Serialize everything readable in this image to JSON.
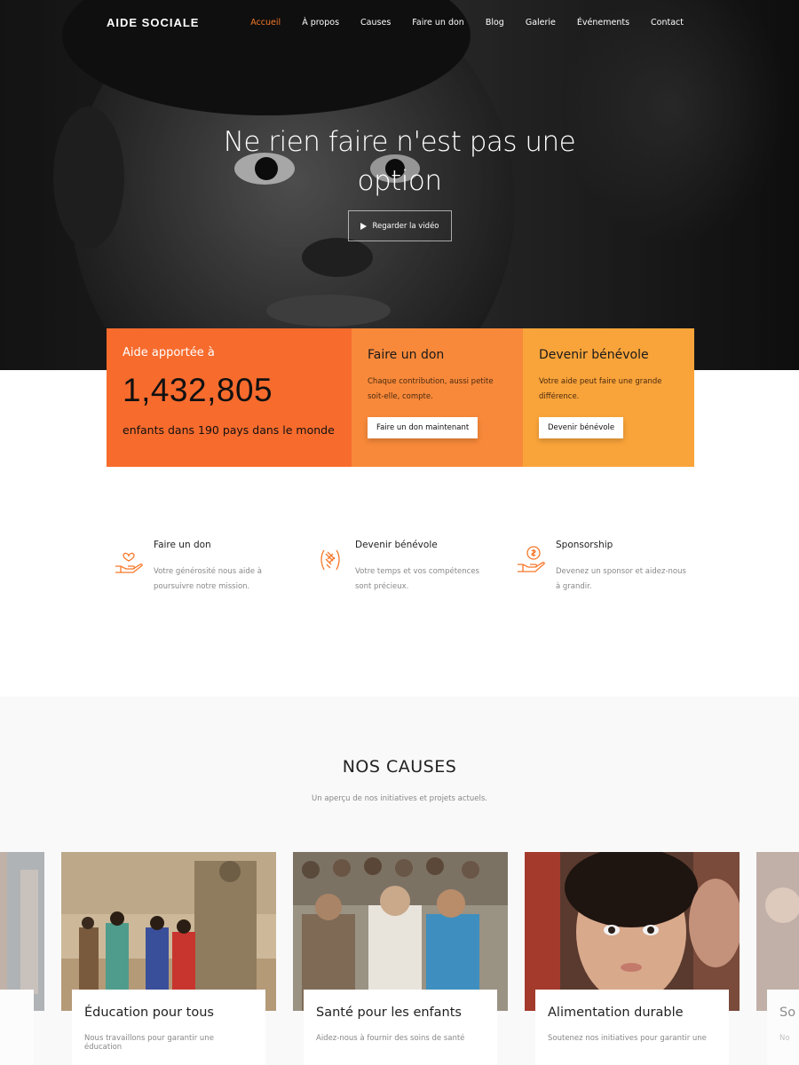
{
  "brand": "AIDE SOCIALE",
  "nav": {
    "items": [
      "Accueil",
      "À propos",
      "Causes",
      "Faire un don",
      "Blog",
      "Galerie",
      "Événements",
      "Contact"
    ],
    "active": "Accueil"
  },
  "hero": {
    "title_line1": "Ne rien faire n'est pas une",
    "title_line2": "option",
    "video_button": "Regarder la vidéo",
    "video_icon": "play-icon"
  },
  "stats": {
    "label": "Aide apportée à",
    "number": "1,432,805",
    "subtitle": "enfants dans 190 pays dans le monde"
  },
  "donate_box": {
    "title": "Faire un don",
    "text_line1": "Chaque contribution, aussi petite",
    "text_line2": "soit-elle, compte.",
    "button": "Faire un don maintenant"
  },
  "volunteer_box": {
    "title": "Devenir bénévole",
    "text_line1": "Votre aide peut faire une grande",
    "text_line2": "différence.",
    "button": "Devenir bénévole"
  },
  "features": [
    {
      "icon": "heart-hand-icon",
      "title": "Faire un don",
      "text_line1": "Votre générosité nous aide à",
      "text_line2": "poursuivre notre mission."
    },
    {
      "icon": "hands-icon",
      "title": "Devenir bénévole",
      "text_line1": "Votre temps et vos compétences",
      "text_line2": "sont précieux."
    },
    {
      "icon": "coin-hand-icon",
      "title": "Sponsorship",
      "text_line1": "Devenez un sponsor et aidez-nous",
      "text_line2": "à grandir."
    }
  ],
  "causes": {
    "title": "NOS CAUSES",
    "subtitle": "Un aperçu de nos initiatives et projets actuels.",
    "cards": [
      {
        "title": "Éducation pour tous",
        "text": "Nous travaillons pour garantir une éducation"
      },
      {
        "title": "Santé pour les enfants",
        "text": "Aidez-nous à fournir des soins de santé"
      },
      {
        "title": "Alimentation durable",
        "text": "Soutenez nos initiatives pour garantir une"
      }
    ],
    "partial_right": {
      "title": "So",
      "text": "No"
    }
  },
  "colors": {
    "accent": "#f7782a",
    "box1": "#f76b2d",
    "box2": "#f8893a",
    "box3": "#f9a43a"
  }
}
